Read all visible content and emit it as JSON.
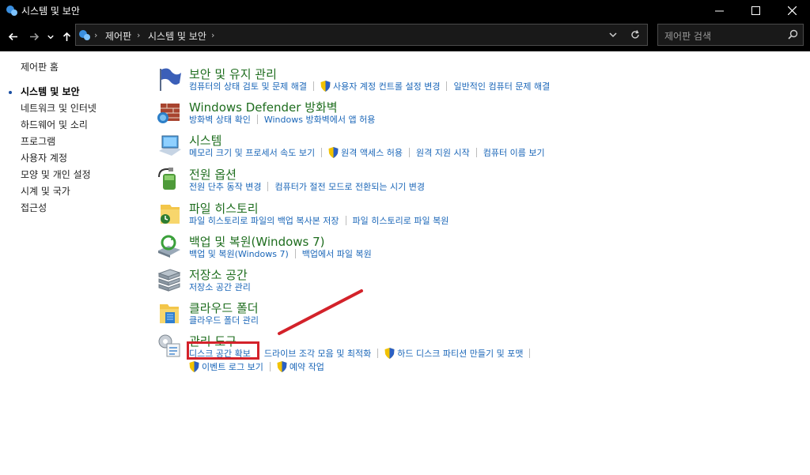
{
  "window": {
    "title": "시스템 및 보안"
  },
  "navigation": {
    "breadcrumbs": [
      "제어판",
      "시스템 및 보안"
    ],
    "search_placeholder": "제어판 검색"
  },
  "sidebar": {
    "home": "제어판 홈",
    "items": [
      {
        "label": "시스템 및 보안",
        "active": true
      },
      {
        "label": "네트워크 및 인터넷"
      },
      {
        "label": "하드웨어 및 소리"
      },
      {
        "label": "프로그램"
      },
      {
        "label": "사용자 계정"
      },
      {
        "label": "모양 및 개인 설정"
      },
      {
        "label": "시계 및 국가"
      },
      {
        "label": "접근성"
      }
    ]
  },
  "categories": [
    {
      "title": "보안 및 유지 관리",
      "icon": "flag-icon",
      "links": [
        "컴퓨터의 상태 검토 및 문제 해결",
        "사용자 계정 컨트롤 설정 변경",
        "일반적인 컴퓨터 문제 해결"
      ]
    },
    {
      "title": "Windows Defender 방화벽",
      "icon": "firewall-icon",
      "links": [
        "방화벽 상태 확인",
        "Windows 방화벽에서 앱 허용"
      ]
    },
    {
      "title": "시스템",
      "icon": "computer-icon",
      "links": [
        "메모리 크기 및 프로세서 속도 보기",
        "원격 액세스 허용",
        "원격 지원 시작",
        "컴퓨터 이름 보기"
      ]
    },
    {
      "title": "전원 옵션",
      "icon": "power-icon",
      "links": [
        "전원 단추 동작 변경",
        "컴퓨터가 절전 모드로 전환되는 시기 변경"
      ]
    },
    {
      "title": "파일 히스토리",
      "icon": "file-history-icon",
      "links": [
        "파일 히스토리로 파일의 백업 복사본 저장",
        "파일 히스토리로 파일 복원"
      ]
    },
    {
      "title": "백업 및 복원(Windows 7)",
      "icon": "backup-icon",
      "links": [
        "백업 및 복원(Windows 7)",
        "백업에서 파일 복원"
      ]
    },
    {
      "title": "저장소 공간",
      "icon": "storage-icon",
      "links": [
        "저장소 공간 관리"
      ]
    },
    {
      "title": "클라우드 폴더",
      "icon": "cloud-folder-icon",
      "links": [
        "클라우드 폴더 관리"
      ]
    },
    {
      "title": "관리 도구",
      "icon": "admin-tools-icon",
      "links": [
        "디스크 공간 확보",
        "드라이브 조각 모음 및 최적화",
        "하드 디스크 파티션 만들기 및 포맷",
        "이벤트 로그 보기",
        "예약 작업"
      ]
    }
  ],
  "colors": {
    "category_title": "#1e6d1e",
    "link": "#1a66b8",
    "annotation": "#d3222a"
  }
}
